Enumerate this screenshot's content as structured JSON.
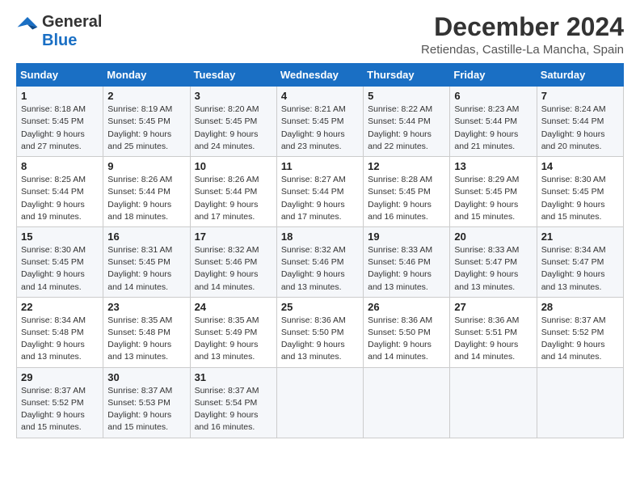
{
  "logo": {
    "line1": "General",
    "line2": "Blue"
  },
  "title": "December 2024",
  "subtitle": "Retiendas, Castille-La Mancha, Spain",
  "days_of_week": [
    "Sunday",
    "Monday",
    "Tuesday",
    "Wednesday",
    "Thursday",
    "Friday",
    "Saturday"
  ],
  "weeks": [
    [
      {
        "day": "1",
        "info": "Sunrise: 8:18 AM\nSunset: 5:45 PM\nDaylight: 9 hours and 27 minutes."
      },
      {
        "day": "2",
        "info": "Sunrise: 8:19 AM\nSunset: 5:45 PM\nDaylight: 9 hours and 25 minutes."
      },
      {
        "day": "3",
        "info": "Sunrise: 8:20 AM\nSunset: 5:45 PM\nDaylight: 9 hours and 24 minutes."
      },
      {
        "day": "4",
        "info": "Sunrise: 8:21 AM\nSunset: 5:45 PM\nDaylight: 9 hours and 23 minutes."
      },
      {
        "day": "5",
        "info": "Sunrise: 8:22 AM\nSunset: 5:44 PM\nDaylight: 9 hours and 22 minutes."
      },
      {
        "day": "6",
        "info": "Sunrise: 8:23 AM\nSunset: 5:44 PM\nDaylight: 9 hours and 21 minutes."
      },
      {
        "day": "7",
        "info": "Sunrise: 8:24 AM\nSunset: 5:44 PM\nDaylight: 9 hours and 20 minutes."
      }
    ],
    [
      {
        "day": "8",
        "info": "Sunrise: 8:25 AM\nSunset: 5:44 PM\nDaylight: 9 hours and 19 minutes."
      },
      {
        "day": "9",
        "info": "Sunrise: 8:26 AM\nSunset: 5:44 PM\nDaylight: 9 hours and 18 minutes."
      },
      {
        "day": "10",
        "info": "Sunrise: 8:26 AM\nSunset: 5:44 PM\nDaylight: 9 hours and 17 minutes."
      },
      {
        "day": "11",
        "info": "Sunrise: 8:27 AM\nSunset: 5:44 PM\nDaylight: 9 hours and 17 minutes."
      },
      {
        "day": "12",
        "info": "Sunrise: 8:28 AM\nSunset: 5:45 PM\nDaylight: 9 hours and 16 minutes."
      },
      {
        "day": "13",
        "info": "Sunrise: 8:29 AM\nSunset: 5:45 PM\nDaylight: 9 hours and 15 minutes."
      },
      {
        "day": "14",
        "info": "Sunrise: 8:30 AM\nSunset: 5:45 PM\nDaylight: 9 hours and 15 minutes."
      }
    ],
    [
      {
        "day": "15",
        "info": "Sunrise: 8:30 AM\nSunset: 5:45 PM\nDaylight: 9 hours and 14 minutes."
      },
      {
        "day": "16",
        "info": "Sunrise: 8:31 AM\nSunset: 5:45 PM\nDaylight: 9 hours and 14 minutes."
      },
      {
        "day": "17",
        "info": "Sunrise: 8:32 AM\nSunset: 5:46 PM\nDaylight: 9 hours and 14 minutes."
      },
      {
        "day": "18",
        "info": "Sunrise: 8:32 AM\nSunset: 5:46 PM\nDaylight: 9 hours and 13 minutes."
      },
      {
        "day": "19",
        "info": "Sunrise: 8:33 AM\nSunset: 5:46 PM\nDaylight: 9 hours and 13 minutes."
      },
      {
        "day": "20",
        "info": "Sunrise: 8:33 AM\nSunset: 5:47 PM\nDaylight: 9 hours and 13 minutes."
      },
      {
        "day": "21",
        "info": "Sunrise: 8:34 AM\nSunset: 5:47 PM\nDaylight: 9 hours and 13 minutes."
      }
    ],
    [
      {
        "day": "22",
        "info": "Sunrise: 8:34 AM\nSunset: 5:48 PM\nDaylight: 9 hours and 13 minutes."
      },
      {
        "day": "23",
        "info": "Sunrise: 8:35 AM\nSunset: 5:48 PM\nDaylight: 9 hours and 13 minutes."
      },
      {
        "day": "24",
        "info": "Sunrise: 8:35 AM\nSunset: 5:49 PM\nDaylight: 9 hours and 13 minutes."
      },
      {
        "day": "25",
        "info": "Sunrise: 8:36 AM\nSunset: 5:50 PM\nDaylight: 9 hours and 13 minutes."
      },
      {
        "day": "26",
        "info": "Sunrise: 8:36 AM\nSunset: 5:50 PM\nDaylight: 9 hours and 14 minutes."
      },
      {
        "day": "27",
        "info": "Sunrise: 8:36 AM\nSunset: 5:51 PM\nDaylight: 9 hours and 14 minutes."
      },
      {
        "day": "28",
        "info": "Sunrise: 8:37 AM\nSunset: 5:52 PM\nDaylight: 9 hours and 14 minutes."
      }
    ],
    [
      {
        "day": "29",
        "info": "Sunrise: 8:37 AM\nSunset: 5:52 PM\nDaylight: 9 hours and 15 minutes."
      },
      {
        "day": "30",
        "info": "Sunrise: 8:37 AM\nSunset: 5:53 PM\nDaylight: 9 hours and 15 minutes."
      },
      {
        "day": "31",
        "info": "Sunrise: 8:37 AM\nSunset: 5:54 PM\nDaylight: 9 hours and 16 minutes."
      },
      null,
      null,
      null,
      null
    ]
  ]
}
